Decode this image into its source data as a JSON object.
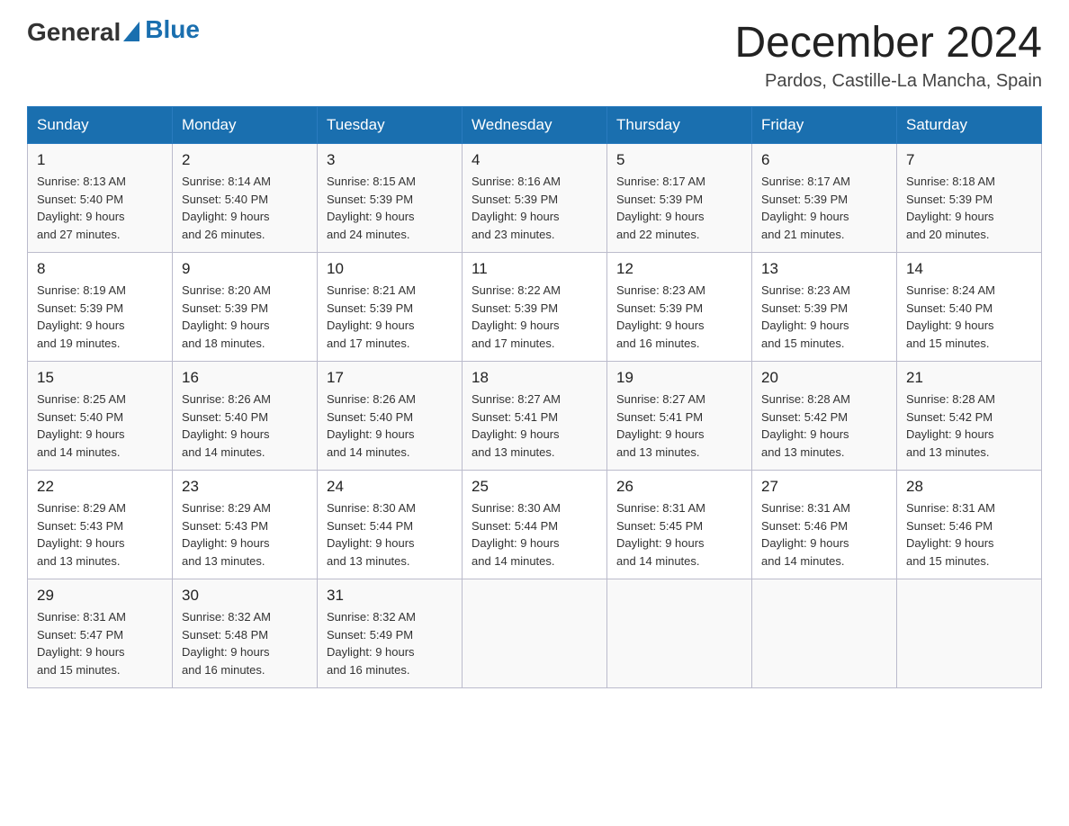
{
  "logo": {
    "general": "General",
    "blue": "Blue"
  },
  "title": "December 2024",
  "subtitle": "Pardos, Castille-La Mancha, Spain",
  "days_of_week": [
    "Sunday",
    "Monday",
    "Tuesday",
    "Wednesday",
    "Thursday",
    "Friday",
    "Saturday"
  ],
  "weeks": [
    [
      {
        "day": "1",
        "sunrise": "8:13 AM",
        "sunset": "5:40 PM",
        "daylight": "9 hours and 27 minutes."
      },
      {
        "day": "2",
        "sunrise": "8:14 AM",
        "sunset": "5:40 PM",
        "daylight": "9 hours and 26 minutes."
      },
      {
        "day": "3",
        "sunrise": "8:15 AM",
        "sunset": "5:39 PM",
        "daylight": "9 hours and 24 minutes."
      },
      {
        "day": "4",
        "sunrise": "8:16 AM",
        "sunset": "5:39 PM",
        "daylight": "9 hours and 23 minutes."
      },
      {
        "day": "5",
        "sunrise": "8:17 AM",
        "sunset": "5:39 PM",
        "daylight": "9 hours and 22 minutes."
      },
      {
        "day": "6",
        "sunrise": "8:17 AM",
        "sunset": "5:39 PM",
        "daylight": "9 hours and 21 minutes."
      },
      {
        "day": "7",
        "sunrise": "8:18 AM",
        "sunset": "5:39 PM",
        "daylight": "9 hours and 20 minutes."
      }
    ],
    [
      {
        "day": "8",
        "sunrise": "8:19 AM",
        "sunset": "5:39 PM",
        "daylight": "9 hours and 19 minutes."
      },
      {
        "day": "9",
        "sunrise": "8:20 AM",
        "sunset": "5:39 PM",
        "daylight": "9 hours and 18 minutes."
      },
      {
        "day": "10",
        "sunrise": "8:21 AM",
        "sunset": "5:39 PM",
        "daylight": "9 hours and 17 minutes."
      },
      {
        "day": "11",
        "sunrise": "8:22 AM",
        "sunset": "5:39 PM",
        "daylight": "9 hours and 17 minutes."
      },
      {
        "day": "12",
        "sunrise": "8:23 AM",
        "sunset": "5:39 PM",
        "daylight": "9 hours and 16 minutes."
      },
      {
        "day": "13",
        "sunrise": "8:23 AM",
        "sunset": "5:39 PM",
        "daylight": "9 hours and 15 minutes."
      },
      {
        "day": "14",
        "sunrise": "8:24 AM",
        "sunset": "5:40 PM",
        "daylight": "9 hours and 15 minutes."
      }
    ],
    [
      {
        "day": "15",
        "sunrise": "8:25 AM",
        "sunset": "5:40 PM",
        "daylight": "9 hours and 14 minutes."
      },
      {
        "day": "16",
        "sunrise": "8:26 AM",
        "sunset": "5:40 PM",
        "daylight": "9 hours and 14 minutes."
      },
      {
        "day": "17",
        "sunrise": "8:26 AM",
        "sunset": "5:40 PM",
        "daylight": "9 hours and 14 minutes."
      },
      {
        "day": "18",
        "sunrise": "8:27 AM",
        "sunset": "5:41 PM",
        "daylight": "9 hours and 13 minutes."
      },
      {
        "day": "19",
        "sunrise": "8:27 AM",
        "sunset": "5:41 PM",
        "daylight": "9 hours and 13 minutes."
      },
      {
        "day": "20",
        "sunrise": "8:28 AM",
        "sunset": "5:42 PM",
        "daylight": "9 hours and 13 minutes."
      },
      {
        "day": "21",
        "sunrise": "8:28 AM",
        "sunset": "5:42 PM",
        "daylight": "9 hours and 13 minutes."
      }
    ],
    [
      {
        "day": "22",
        "sunrise": "8:29 AM",
        "sunset": "5:43 PM",
        "daylight": "9 hours and 13 minutes."
      },
      {
        "day": "23",
        "sunrise": "8:29 AM",
        "sunset": "5:43 PM",
        "daylight": "9 hours and 13 minutes."
      },
      {
        "day": "24",
        "sunrise": "8:30 AM",
        "sunset": "5:44 PM",
        "daylight": "9 hours and 13 minutes."
      },
      {
        "day": "25",
        "sunrise": "8:30 AM",
        "sunset": "5:44 PM",
        "daylight": "9 hours and 14 minutes."
      },
      {
        "day": "26",
        "sunrise": "8:31 AM",
        "sunset": "5:45 PM",
        "daylight": "9 hours and 14 minutes."
      },
      {
        "day": "27",
        "sunrise": "8:31 AM",
        "sunset": "5:46 PM",
        "daylight": "9 hours and 14 minutes."
      },
      {
        "day": "28",
        "sunrise": "8:31 AM",
        "sunset": "5:46 PM",
        "daylight": "9 hours and 15 minutes."
      }
    ],
    [
      {
        "day": "29",
        "sunrise": "8:31 AM",
        "sunset": "5:47 PM",
        "daylight": "9 hours and 15 minutes."
      },
      {
        "day": "30",
        "sunrise": "8:32 AM",
        "sunset": "5:48 PM",
        "daylight": "9 hours and 16 minutes."
      },
      {
        "day": "31",
        "sunrise": "8:32 AM",
        "sunset": "5:49 PM",
        "daylight": "9 hours and 16 minutes."
      },
      null,
      null,
      null,
      null
    ]
  ]
}
